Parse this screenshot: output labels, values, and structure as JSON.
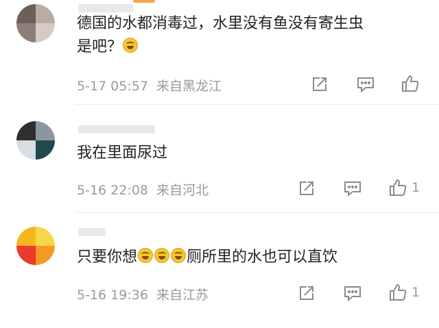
{
  "comments": [
    {
      "text_before": "德国的水都消毒过，水里没有鱼没有寄生虫",
      "text_line2": "是吧？",
      "time": "5-17 05:57",
      "location": "来自黑龙江",
      "like_count": ""
    },
    {
      "text": "我在里面尿过",
      "time": "5-16 22:08",
      "location": "来自河北",
      "like_count": "1"
    },
    {
      "text_before": "只要你想",
      "text_after": "厕所里的水也可以直饮",
      "time": "5-16 19:36",
      "location": "来自江苏",
      "like_count": "1"
    }
  ],
  "icons": {
    "share": "share-icon",
    "comment": "comment-icon",
    "like": "thumbs-up-icon",
    "emoji": "laugh-cry-emoji"
  },
  "colors": {
    "accent": "#f3a64a",
    "text": "#222222",
    "meta": "#9a9a9a"
  }
}
